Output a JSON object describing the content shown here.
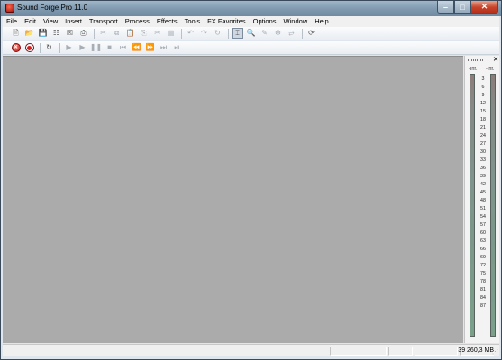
{
  "window": {
    "title": "Sound Forge Pro 11.0",
    "minimize_glyph": "–",
    "maximize_glyph": "□",
    "close_glyph": "✕"
  },
  "menubar": {
    "items": [
      "File",
      "Edit",
      "View",
      "Insert",
      "Transport",
      "Process",
      "Effects",
      "Tools",
      "FX Favorites",
      "Options",
      "Window",
      "Help"
    ]
  },
  "toolbar_main": {
    "new_glyph": "🗎",
    "open_glyph": "📂",
    "save_glyph": "💾",
    "save_all_glyph": "☷",
    "render_glyph": "☒",
    "print_glyph": "⎙",
    "cut_glyph": "✂",
    "copy_glyph": "⧉",
    "paste_glyph": "📋",
    "paste_mix_glyph": "⎘",
    "trim_glyph": "✂",
    "crop_glyph": "▤",
    "undo_glyph": "↶",
    "redo_glyph": "↷",
    "repeat_glyph": "↻",
    "edit_tool_glyph": "⌶",
    "magnify_tool_glyph": "🔍",
    "pencil_tool_glyph": "✎",
    "envelope_tool_glyph": "❆",
    "event_tool_glyph": "⥂",
    "refresh_glyph": "⟳"
  },
  "toolbar_transport": {
    "stop_record_glyph": "✕",
    "play_all_glyph": "▶",
    "play_glyph": "▶",
    "pause_glyph": "❚❚",
    "stop_glyph": "■",
    "go_start_glyph": "⏮",
    "rewind_glyph": "⏪",
    "forward_glyph": "⏩",
    "go_end_glyph": "⏭",
    "loop_glyph": "↻",
    "last_glyph": "⏯"
  },
  "meters": {
    "left_peak": "-Inf.",
    "right_peak": "-Inf.",
    "close_glyph": "✕",
    "scale": [
      "3",
      "6",
      "9",
      "12",
      "15",
      "18",
      "21",
      "24",
      "27",
      "30",
      "33",
      "36",
      "39",
      "42",
      "45",
      "48",
      "51",
      "54",
      "57",
      "60",
      "63",
      "66",
      "69",
      "72",
      "75",
      "78",
      "81",
      "84",
      "87"
    ]
  },
  "statusbar": {
    "memory": "39 260,3 MB",
    "sizegrip_glyph": "⋰"
  }
}
